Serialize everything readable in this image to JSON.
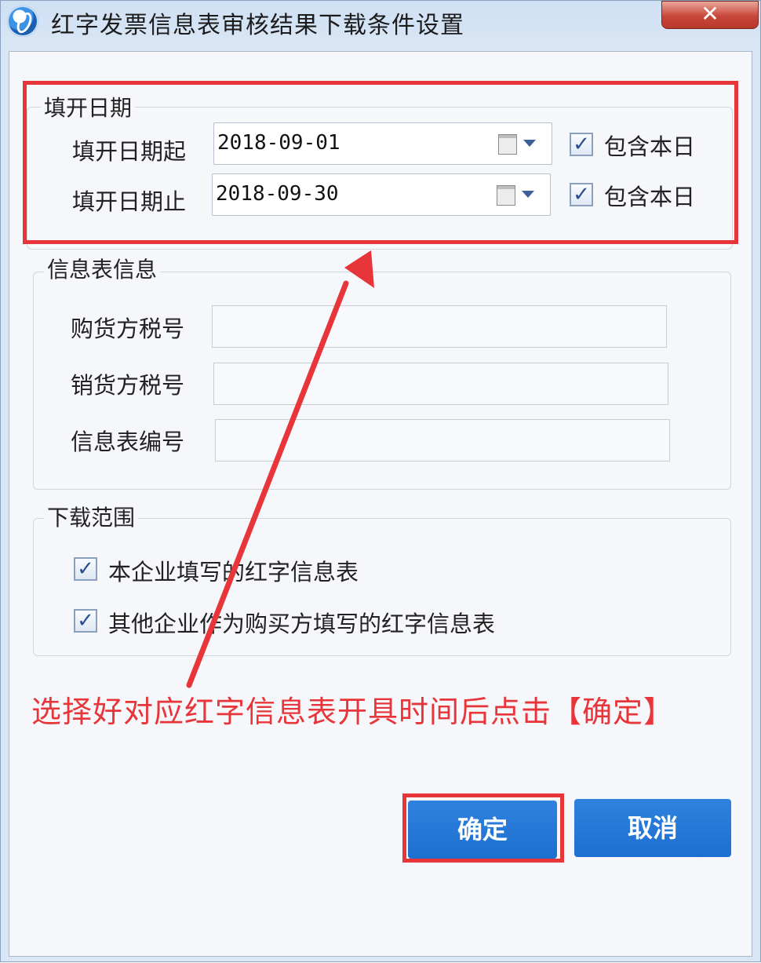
{
  "window": {
    "title": "红字发票信息表审核结果下载条件设置",
    "close_label": "✕"
  },
  "date_group": {
    "legend": "填开日期",
    "start": {
      "label": "填开日期起",
      "value": "2018-09-01",
      "include_label": "包含本日",
      "include_checked": true
    },
    "end": {
      "label": "填开日期止",
      "value": "2018-09-30",
      "include_label": "包含本日",
      "include_checked": true
    }
  },
  "info_group": {
    "legend": "信息表信息",
    "buyer_tax": {
      "label": "购货方税号",
      "value": ""
    },
    "seller_tax": {
      "label": "销货方税号",
      "value": ""
    },
    "form_no": {
      "label": "信息表编号",
      "value": ""
    }
  },
  "range_group": {
    "legend": "下载范围",
    "own": {
      "label": "本企业填写的红字信息表",
      "checked": true
    },
    "others": {
      "label": "其他企业作为购买方填写的红字信息表",
      "checked": true
    }
  },
  "annotation": {
    "text": "选择好对应红字信息表开具时间后点击【确定】",
    "color": "#e8353a"
  },
  "buttons": {
    "confirm": "确定",
    "cancel": "取消"
  },
  "check_mark": "✓"
}
